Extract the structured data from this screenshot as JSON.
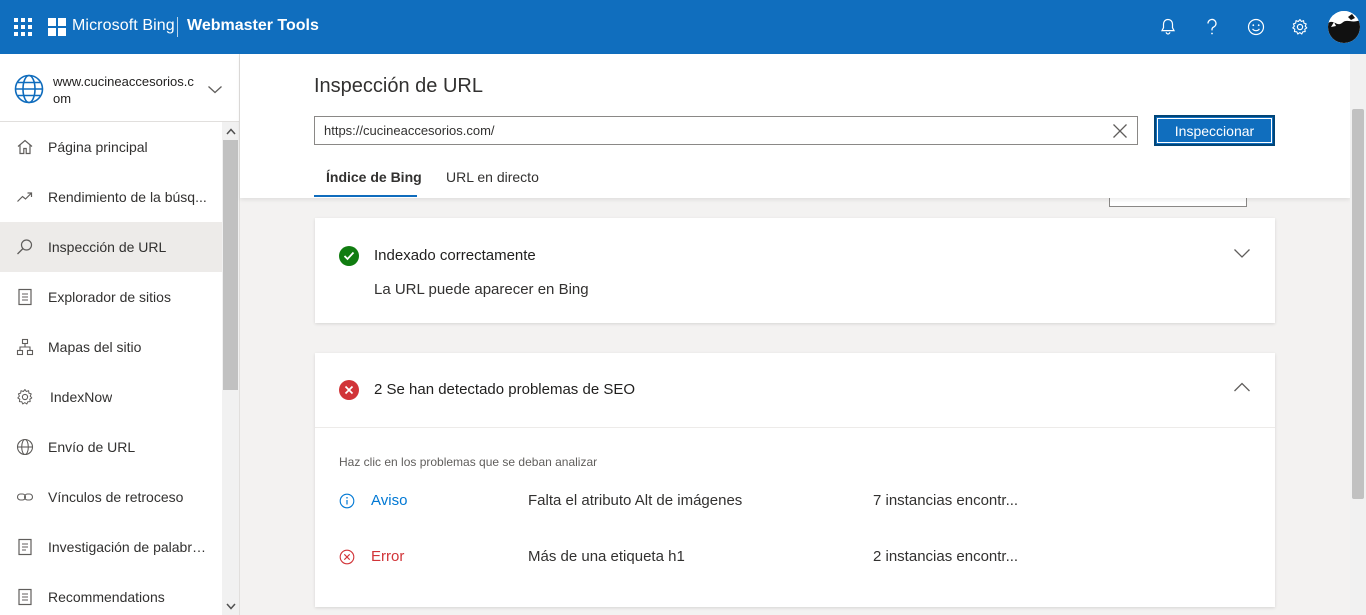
{
  "topbar": {
    "brand": "Microsoft Bing",
    "product": "Webmaster Tools",
    "icons": [
      "waffle-icon",
      "bell-icon",
      "help-icon",
      "smiley-icon",
      "gear-icon"
    ],
    "color": "#106ebe"
  },
  "sidebar": {
    "site": "www.cucineaccesorios.com",
    "items": [
      {
        "label": "Página principal",
        "icon": "home-icon"
      },
      {
        "label": "Rendimiento de la búsq...",
        "icon": "trend-icon"
      },
      {
        "label": "Inspección de URL",
        "icon": "search-icon",
        "active": true
      },
      {
        "label": "Explorador de sitios",
        "icon": "document-icon"
      },
      {
        "label": "Mapas del sitio",
        "icon": "sitemap-icon"
      },
      {
        "label": "IndexNow",
        "icon": "gear-icon"
      },
      {
        "label": "Envío de URL",
        "icon": "globe-icon"
      },
      {
        "label": "Vínculos de retroceso",
        "icon": "link-icon"
      },
      {
        "label": "Investigación de palabra...",
        "icon": "document-icon"
      },
      {
        "label": "Recommendations",
        "icon": "document-icon"
      }
    ]
  },
  "main": {
    "title": "Inspección de URL",
    "url_value": "https://cucineaccesorios.com/",
    "inspect_label": "Inspeccionar",
    "tabs": [
      {
        "label": "Índice de Bing",
        "active": true
      },
      {
        "label": "URL en directo",
        "active": false
      }
    ],
    "index_card": {
      "title": "Indexado correctamente",
      "subtitle": "La URL puede aparecer en Bing",
      "status_color": "#107c10"
    },
    "seo_card": {
      "title": "2 Se han detectado problemas de SEO",
      "hint": "Haz clic en los problemas que se deban analizar",
      "status_color": "#d13438",
      "issues": [
        {
          "severity": "Aviso",
          "name": "Falta el atributo Alt de imágenes",
          "count": "7 instancias encontr...",
          "color": "#0078d4",
          "icon": "info-icon"
        },
        {
          "severity": "Error",
          "name": "Más de una etiqueta h1",
          "count": "2 instancias encontr...",
          "color": "#d13438",
          "icon": "error-icon"
        }
      ]
    }
  }
}
